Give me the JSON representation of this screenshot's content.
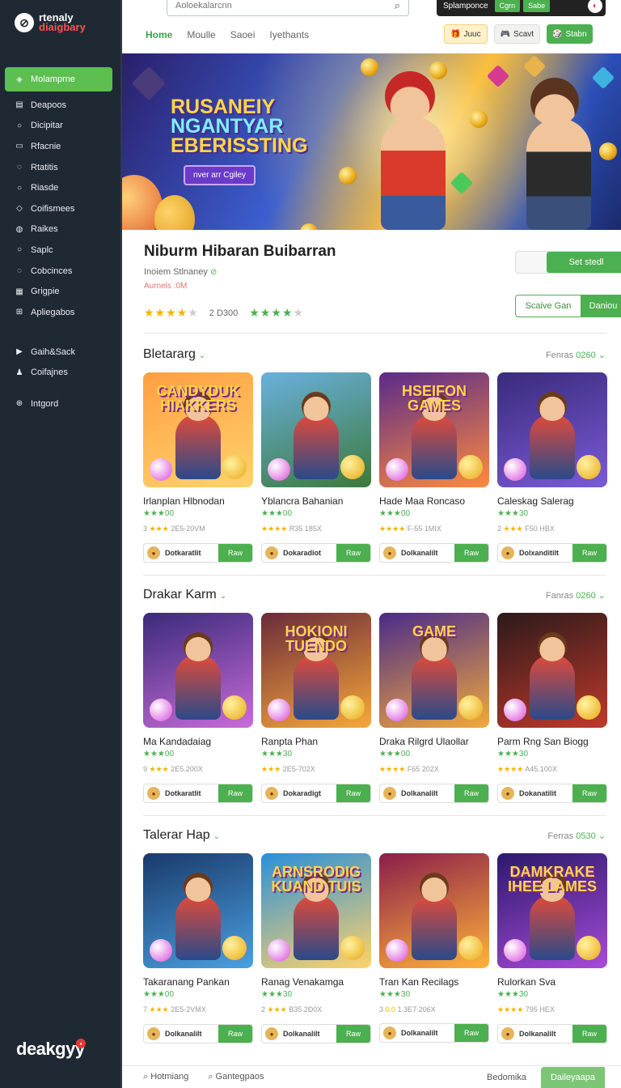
{
  "sidebar": {
    "logo_line1": "rtenaly",
    "logo_line2": "diaigbary",
    "active_item": "Molamprne",
    "items": [
      {
        "label": "Deapoos",
        "icon": "book-icon"
      },
      {
        "label": "Dicipitar",
        "icon": "circle-icon"
      },
      {
        "label": "Rfacnie",
        "icon": "file-icon"
      },
      {
        "label": "Rtatitis",
        "icon": "chat-icon"
      },
      {
        "label": "Riasde",
        "icon": "circle-icon"
      },
      {
        "label": "Coifismees",
        "icon": "wifi-icon"
      },
      {
        "label": "Raikes",
        "icon": "location-icon"
      },
      {
        "label": "Saplc",
        "icon": "circle-icon"
      },
      {
        "label": "Cobcinces",
        "icon": "chat-icon"
      },
      {
        "label": "Grigpie",
        "icon": "grid-icon"
      },
      {
        "label": "Apliegabos",
        "icon": "grid-icon"
      }
    ],
    "items2": [
      {
        "label": "Gaih&Sack",
        "icon": "play-icon"
      },
      {
        "label": "Coifajnes",
        "icon": "user-icon"
      }
    ],
    "items3": [
      {
        "label": "Intgord",
        "icon": "globe-icon"
      }
    ],
    "brand": "deakgyy"
  },
  "topbar": {
    "search_placeholder": "Aoloekalarcnn",
    "right_label": "Splamponce",
    "right_btn1": "Cgrn",
    "right_btn2": "Sabe",
    "tabs": [
      "Home",
      "Moulle",
      "Saoei",
      "Iyethants"
    ],
    "btn_yellow": "Juuc",
    "btn_light": "Scavt",
    "btn_green": "Stabn"
  },
  "banner": {
    "line1": "RUSANEIY",
    "line2": "NGANTYAR",
    "line3": "EBERISSTING",
    "button": "nver arr Cgiley"
  },
  "game": {
    "title": "Niburm Hibaran Buibarran",
    "developer": "Inoiem Stlnaney",
    "rating_sub": "Aurnels :0M",
    "rating_count": "2 D300",
    "get_button": "Set stedl",
    "save_left": "Scaive Gan",
    "save_right": "Daniou"
  },
  "sections": [
    {
      "title": "Bletararg",
      "more_label": "Fenras",
      "more_num": "0260",
      "cards": [
        {
          "title": "Irlanplan Hlbnodan",
          "stars": "★★★00",
          "meta_pre": "3",
          "meta_stars": "★★★",
          "meta": "2E5-20VM",
          "dl": "Dotkaratlit",
          "go": "Raw",
          "label": "CANDYDUK HIAKKERS"
        },
        {
          "title": "Yblancra Bahanian",
          "stars": "★★★00",
          "meta_pre": "",
          "meta_stars": "★★★★",
          "meta": "R35 185X",
          "dl": "Dokaradiot",
          "go": "Raw",
          "label": ""
        },
        {
          "title": "Hade Maa Roncaso",
          "stars": "★★★00",
          "meta_pre": "",
          "meta_stars": "★★★★",
          "meta": "F-55 1MIX",
          "dl": "Dolkanalilt",
          "go": "Raw",
          "label": "HSEIFON GAMES"
        },
        {
          "title": "Caleskag Salerag",
          "stars": "★★★30",
          "meta_pre": "2",
          "meta_stars": "★★★",
          "meta": "F50 HBX",
          "dl": "Dolxanditilt",
          "go": "Raw",
          "label": ""
        }
      ]
    },
    {
      "title": "Drakar Karm",
      "more_label": "Fanras",
      "more_num": "0260",
      "cards": [
        {
          "title": "Ma Kandadaiag",
          "stars": "★★★00",
          "meta_pre": "9",
          "meta_stars": "★★★",
          "meta": "2E5.200X",
          "dl": "Dotkaratlit",
          "go": "Raw",
          "label": ""
        },
        {
          "title": "Ranpta Phan",
          "stars": "★★★30",
          "meta_pre": "",
          "meta_stars": "★★★",
          "meta": "2E5-702X",
          "dl": "Dokaradigt",
          "go": "Raw",
          "label": "HOKIONI TUENDO"
        },
        {
          "title": "Draka Rilgrd Ulaollar",
          "stars": "★★★00",
          "meta_pre": "",
          "meta_stars": "★★★★",
          "meta": "F65 202X",
          "dl": "Dolkanalilt",
          "go": "Raw",
          "label": "GAME"
        },
        {
          "title": "Parm Rng San Biogg",
          "stars": "★★★30",
          "meta_pre": "",
          "meta_stars": "★★★★",
          "meta": "A45.100X",
          "dl": "Dokanatilit",
          "go": "Raw",
          "label": ""
        }
      ]
    },
    {
      "title": "Talerar Hap",
      "more_label": "Ferras",
      "more_num": "0530",
      "cards": [
        {
          "title": "Takaranang Pankan",
          "stars": "★★★00",
          "meta_pre": "7",
          "meta_stars": "★★★",
          "meta": "2E5-2VMX",
          "dl": "Dolkanalilt",
          "go": "Raw",
          "label": ""
        },
        {
          "title": "Ranag Venakamga",
          "stars": "★★★30",
          "meta_pre": "2",
          "meta_stars": "★★★",
          "meta": "B35 2Ð0X",
          "dl": "Dolkanalilt",
          "go": "Raw",
          "label": "ARNSRODIG KUAND TUIS"
        },
        {
          "title": "Tran Kan Recilags",
          "stars": "★★★30",
          "meta_pre": "3",
          "meta_stars": "0.0",
          "meta": "1.3E7 206X",
          "dl": "Dolkanalilt",
          "go": "Raw",
          "label": ""
        },
        {
          "title": "Rulorkan Sva",
          "stars": "★★★30",
          "meta_pre": "",
          "meta_stars": "★★★★",
          "meta": "795 HEX",
          "dl": "Dolkanalilt",
          "go": "Raw",
          "label": "DAMKRAKE IHEE LAMES"
        }
      ]
    }
  ],
  "bottombar": {
    "left1": "Hotmiang",
    "left2": "Gantegpaos",
    "right_label": "Bedomika",
    "right_button": "Daileyaapa"
  },
  "colors": {
    "accent": "#4caf50",
    "sidebar_bg": "#1f2933",
    "star": "#f4b400"
  }
}
